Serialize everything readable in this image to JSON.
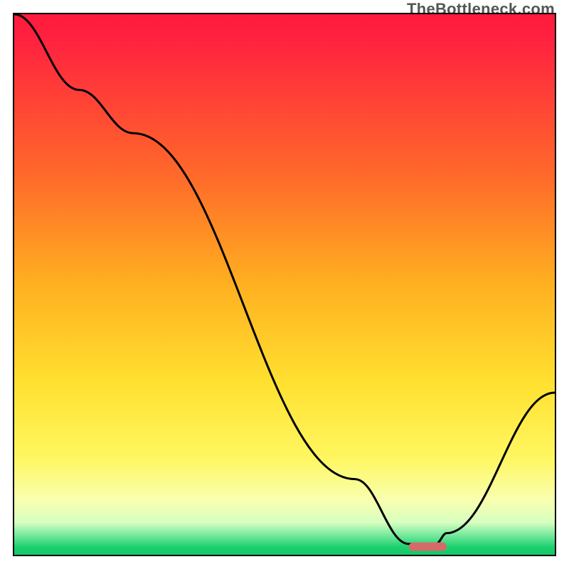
{
  "watermark": "TheBottleneck.com",
  "chart_data": {
    "type": "line",
    "title": "",
    "xlabel": "",
    "ylabel": "",
    "xlim": [
      0,
      100
    ],
    "ylim": [
      0,
      100
    ],
    "grid": false,
    "legend": false,
    "series": [
      {
        "name": "bottleneck-curve",
        "x": [
          0,
          12,
          22,
          63,
          73,
          78,
          80,
          100
        ],
        "y": [
          100,
          86,
          78,
          14,
          2,
          2,
          4,
          30
        ]
      }
    ],
    "marker": {
      "name": "optimal-range",
      "x_start": 73,
      "x_end": 80,
      "y": 1.5,
      "color": "#d66a6a"
    },
    "background_gradient_stops": [
      {
        "offset": 0.0,
        "color": "#ff1a3a"
      },
      {
        "offset": 0.04,
        "color": "#ff2040"
      },
      {
        "offset": 0.3,
        "color": "#ff6a2a"
      },
      {
        "offset": 0.5,
        "color": "#ffb020"
      },
      {
        "offset": 0.68,
        "color": "#ffe030"
      },
      {
        "offset": 0.82,
        "color": "#fff760"
      },
      {
        "offset": 0.9,
        "color": "#f8ffb0"
      },
      {
        "offset": 0.94,
        "color": "#d8ffc0"
      },
      {
        "offset": 0.965,
        "color": "#70e89a"
      },
      {
        "offset": 0.985,
        "color": "#20d070"
      },
      {
        "offset": 1.0,
        "color": "#10c868"
      }
    ]
  }
}
